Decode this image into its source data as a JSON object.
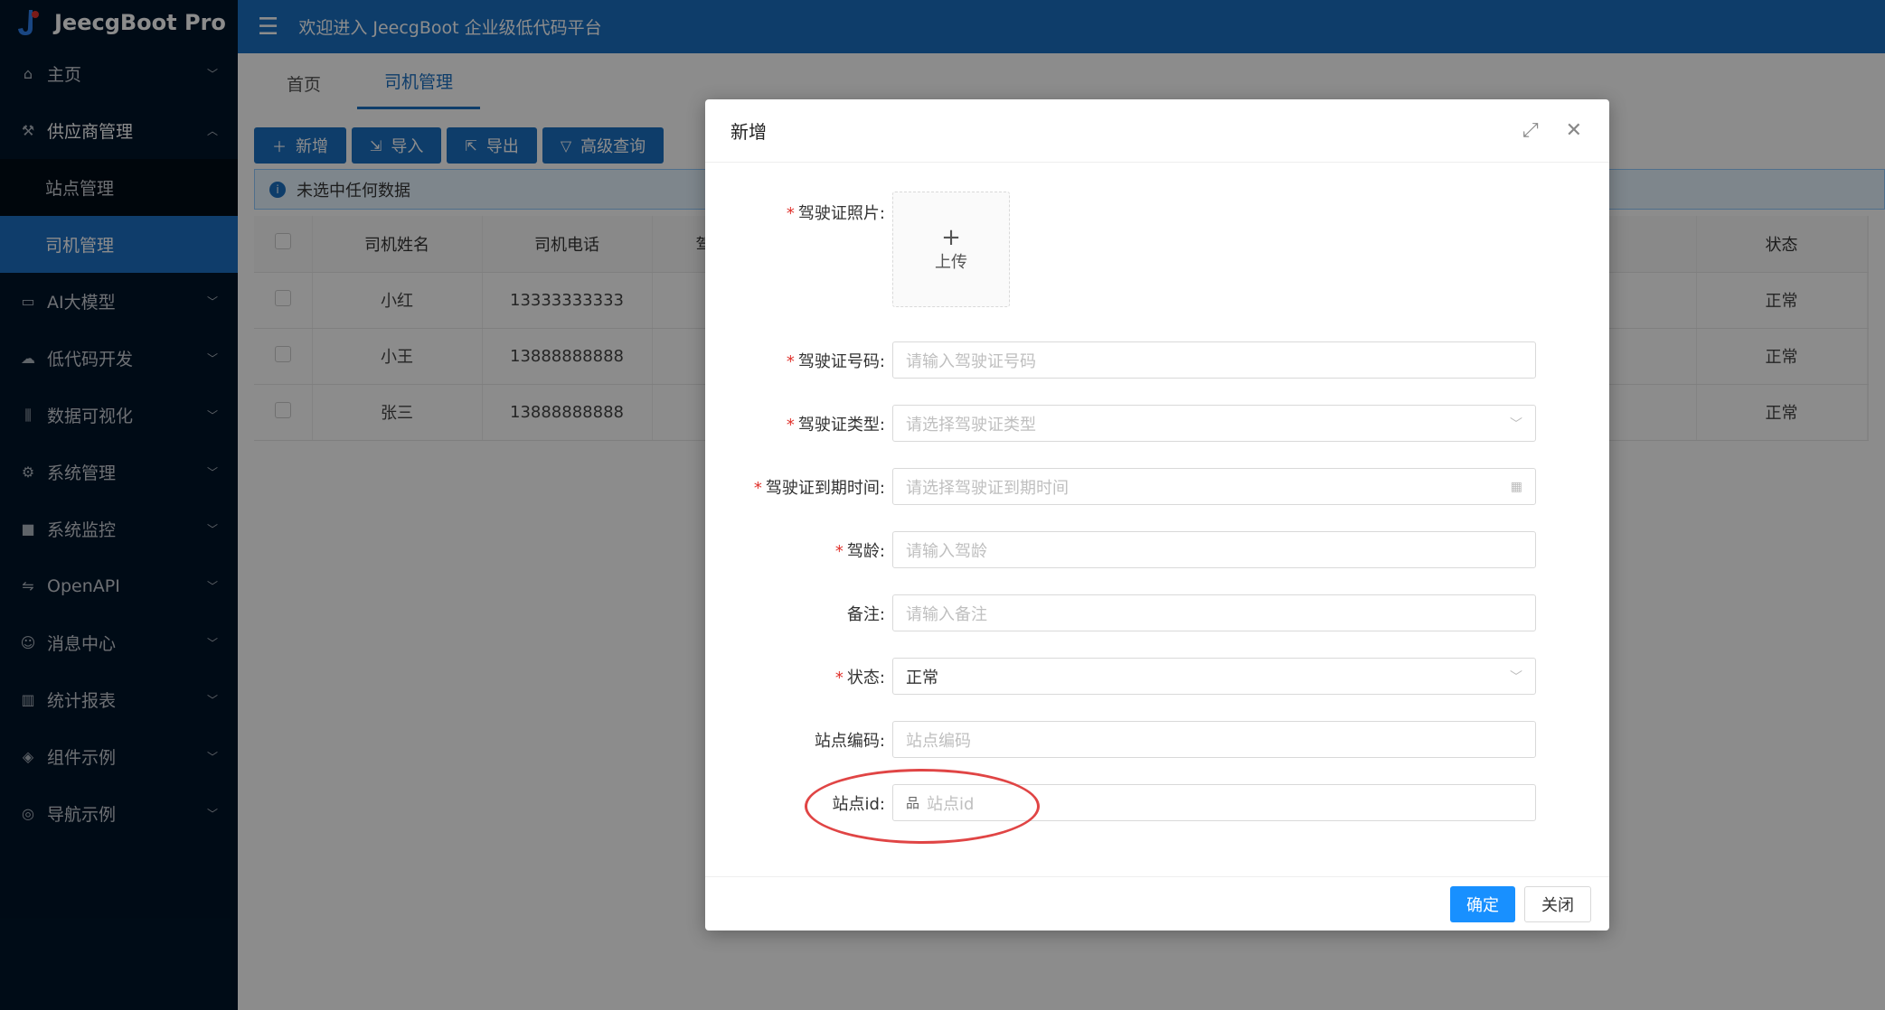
{
  "app": {
    "title": "JeecgBoot Pro",
    "welcome": "欢迎进入 JeecgBoot 企业级低代码平台"
  },
  "sidebar": {
    "items": [
      {
        "label": "主页",
        "icon": "home-icon"
      },
      {
        "label": "供应商管理",
        "icon": "supplier-icon"
      },
      {
        "label": "AI大模型",
        "icon": "ai-icon"
      },
      {
        "label": "低代码开发",
        "icon": "cloud-icon"
      },
      {
        "label": "数据可视化",
        "icon": "chart-icon"
      },
      {
        "label": "系统管理",
        "icon": "gear-icon"
      },
      {
        "label": "系统监控",
        "icon": "monitor-icon"
      },
      {
        "label": "OpenAPI",
        "icon": "swap-icon"
      },
      {
        "label": "消息中心",
        "icon": "message-icon"
      },
      {
        "label": "统计报表",
        "icon": "bar-chart-icon"
      },
      {
        "label": "组件示例",
        "icon": "layers-icon"
      },
      {
        "label": "导航示例",
        "icon": "compass-icon"
      }
    ],
    "sub": [
      {
        "label": "站点管理"
      },
      {
        "label": "司机管理"
      }
    ]
  },
  "tabs": [
    {
      "label": "首页"
    },
    {
      "label": "司机管理"
    }
  ],
  "toolbar": {
    "add": "新增",
    "import": "导入",
    "export": "导出",
    "query": "高级查询"
  },
  "alert": {
    "text": "未选中任何数据"
  },
  "table": {
    "headers": [
      "司机姓名",
      "司机电话",
      "驾",
      "状态"
    ],
    "rows": [
      {
        "name": "小红",
        "phone": "13333333333",
        "status": "正常"
      },
      {
        "name": "小王",
        "phone": "13888888888",
        "status": "正常"
      },
      {
        "name": "张三",
        "phone": "13888888888",
        "status": "正常"
      }
    ]
  },
  "modal": {
    "title": "新增",
    "upload": {
      "label": "驾驶证照片",
      "text": "上传"
    },
    "fields": {
      "license_no": {
        "label": "驾驶证号码",
        "placeholder": "请输入驾驶证号码"
      },
      "license_type": {
        "label": "驾驶证类型",
        "placeholder": "请选择驾驶证类型"
      },
      "license_expire": {
        "label": "驾驶证到期时间",
        "placeholder": "请选择驾驶证到期时间"
      },
      "driving_age": {
        "label": "驾龄",
        "placeholder": "请输入驾龄"
      },
      "remark": {
        "label": "备注",
        "placeholder": "请输入备注"
      },
      "status": {
        "label": "状态",
        "value": "正常"
      },
      "site_code": {
        "label": "站点编码",
        "placeholder": "站点编码"
      },
      "site_id": {
        "label": "站点id",
        "placeholder": "站点id"
      }
    },
    "ok": "确定",
    "cancel": "关闭"
  },
  "colors": {
    "primary": "#1b6fc2",
    "sidebar": "#001529",
    "required": "#e0322c",
    "highlight": "#e04545"
  }
}
